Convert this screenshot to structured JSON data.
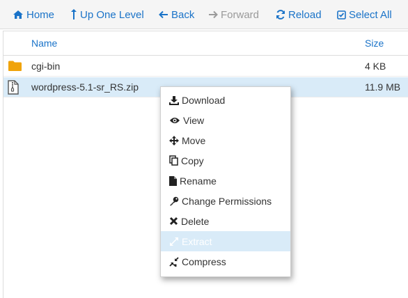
{
  "toolbar": {
    "home": "Home",
    "up_one_level": "Up One Level",
    "back": "Back",
    "forward": "Forward",
    "reload": "Reload",
    "select_all": "Select All"
  },
  "table": {
    "columns": {
      "name": "Name",
      "size": "Size"
    },
    "rows": [
      {
        "name": "cgi-bin",
        "size": "4 KB",
        "icon": "folder-icon",
        "selected": false
      },
      {
        "name": "wordpress-5.1-sr_RS.zip",
        "size": "11.9 MB",
        "icon": "zip-file-icon",
        "selected": true
      }
    ]
  },
  "context_menu": {
    "items": [
      {
        "label": "Download",
        "icon": "download-icon"
      },
      {
        "label": "View",
        "icon": "eye-icon"
      },
      {
        "label": "Move",
        "icon": "move-arrows-icon"
      },
      {
        "label": "Copy",
        "icon": "copy-icon"
      },
      {
        "label": "Rename",
        "icon": "file-icon"
      },
      {
        "label": "Change Permissions",
        "icon": "key-icon"
      },
      {
        "label": "Delete",
        "icon": "x-icon"
      },
      {
        "label": "Extract",
        "icon": "expand-icon",
        "highlighted": true
      },
      {
        "label": "Compress",
        "icon": "compress-icon"
      }
    ]
  },
  "colors": {
    "accent": "#1a73c8",
    "selection": "#d9ebf8",
    "folder": "#f0a30a"
  }
}
